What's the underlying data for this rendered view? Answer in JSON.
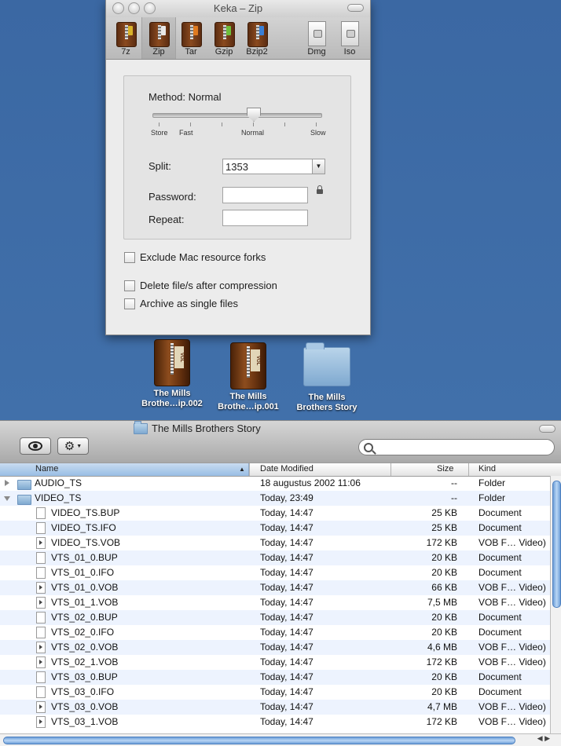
{
  "keka": {
    "title": "Keka – Zip",
    "formats": [
      {
        "label": "7z",
        "icon": "archive-7z-icon",
        "color": "#d8b22a"
      },
      {
        "label": "Zip",
        "icon": "archive-zip-icon",
        "color": "#e8e8e8"
      },
      {
        "label": "Tar",
        "icon": "archive-tar-icon",
        "color": "#e07a1f"
      },
      {
        "label": "Gzip",
        "icon": "archive-gzip-icon",
        "color": "#6fbf3a"
      },
      {
        "label": "Bzip2",
        "icon": "archive-bzip2-icon",
        "color": "#3a7fd4"
      },
      {
        "label": "Dmg",
        "icon": "disk-image-icon"
      },
      {
        "label": "Iso",
        "icon": "iso-image-icon"
      }
    ],
    "selected_format": "Zip",
    "method_label": "Method: Normal",
    "method_level": 0.6,
    "slider_labels": [
      "Store",
      "Fast",
      "Normal",
      "Slow"
    ],
    "split_label": "Split:",
    "split_value": "1353",
    "password_label": "Password:",
    "repeat_label": "Repeat:",
    "exclude_label": "Exclude Mac resource forks",
    "delete_label": "Delete file/s after compression",
    "single_label": "Archive as single files"
  },
  "desktop_icons": [
    {
      "name_line1": "The Mills",
      "name_line2": "Brothe…ip.002"
    },
    {
      "name_line1": "The Mills",
      "name_line2": "Brothe…ip.001"
    },
    {
      "name_line1": "The Mills",
      "name_line2": "Brothers Story"
    }
  ],
  "finder": {
    "title": "The Mills Brothers Story",
    "search_placeholder": "",
    "columns": {
      "name": "Name",
      "date": "Date Modified",
      "size": "Size",
      "kind": "Kind"
    },
    "rows": [
      {
        "name": "AUDIO_TS",
        "date": "18 augustus 2002 11:06",
        "size": "--",
        "kind": "Folder",
        "type": "folder",
        "level": 0,
        "disclosure": "closed"
      },
      {
        "name": "VIDEO_TS",
        "date": "Today, 23:49",
        "size": "--",
        "kind": "Folder",
        "type": "folder",
        "level": 0,
        "disclosure": "open"
      },
      {
        "name": "VIDEO_TS.BUP",
        "date": "Today, 14:47",
        "size": "25 KB",
        "kind": "Document",
        "type": "doc",
        "level": 1
      },
      {
        "name": "VIDEO_TS.IFO",
        "date": "Today, 14:47",
        "size": "25 KB",
        "kind": "Document",
        "type": "doc",
        "level": 1
      },
      {
        "name": "VIDEO_TS.VOB",
        "date": "Today, 14:47",
        "size": "172 KB",
        "kind": "VOB F… Video)",
        "type": "vob",
        "level": 1
      },
      {
        "name": "VTS_01_0.BUP",
        "date": "Today, 14:47",
        "size": "20 KB",
        "kind": "Document",
        "type": "doc",
        "level": 1
      },
      {
        "name": "VTS_01_0.IFO",
        "date": "Today, 14:47",
        "size": "20 KB",
        "kind": "Document",
        "type": "doc",
        "level": 1
      },
      {
        "name": "VTS_01_0.VOB",
        "date": "Today, 14:47",
        "size": "66 KB",
        "kind": "VOB F… Video)",
        "type": "vob",
        "level": 1
      },
      {
        "name": "VTS_01_1.VOB",
        "date": "Today, 14:47",
        "size": "7,5 MB",
        "kind": "VOB F… Video)",
        "type": "vob",
        "level": 1
      },
      {
        "name": "VTS_02_0.BUP",
        "date": "Today, 14:47",
        "size": "20 KB",
        "kind": "Document",
        "type": "doc",
        "level": 1
      },
      {
        "name": "VTS_02_0.IFO",
        "date": "Today, 14:47",
        "size": "20 KB",
        "kind": "Document",
        "type": "doc",
        "level": 1
      },
      {
        "name": "VTS_02_0.VOB",
        "date": "Today, 14:47",
        "size": "4,6 MB",
        "kind": "VOB F… Video)",
        "type": "vob",
        "level": 1
      },
      {
        "name": "VTS_02_1.VOB",
        "date": "Today, 14:47",
        "size": "172 KB",
        "kind": "VOB F… Video)",
        "type": "vob",
        "level": 1
      },
      {
        "name": "VTS_03_0.BUP",
        "date": "Today, 14:47",
        "size": "20 KB",
        "kind": "Document",
        "type": "doc",
        "level": 1
      },
      {
        "name": "VTS_03_0.IFO",
        "date": "Today, 14:47",
        "size": "20 KB",
        "kind": "Document",
        "type": "doc",
        "level": 1
      },
      {
        "name": "VTS_03_0.VOB",
        "date": "Today, 14:47",
        "size": "4,7 MB",
        "kind": "VOB F… Video)",
        "type": "vob",
        "level": 1
      },
      {
        "name": "VTS_03_1.VOB",
        "date": "Today, 14:47",
        "size": "172 KB",
        "kind": "VOB F… Video)",
        "type": "vob",
        "level": 1
      }
    ]
  }
}
